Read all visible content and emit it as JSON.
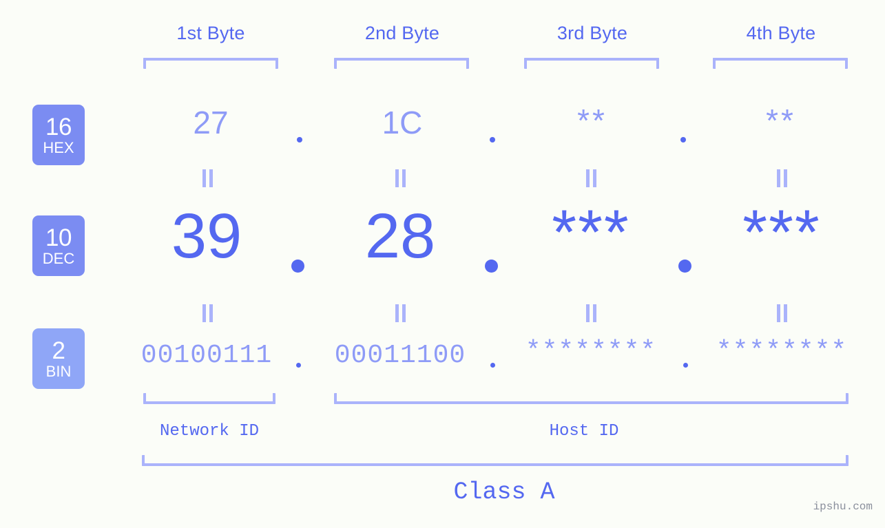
{
  "watermark": "ipshu.com",
  "header": {
    "bytes": [
      {
        "label": "1st Byte"
      },
      {
        "label": "2nd Byte"
      },
      {
        "label": "3rd Byte"
      },
      {
        "label": "4th Byte"
      }
    ]
  },
  "bases": [
    {
      "num": "16",
      "abbr": "HEX",
      "color": "#7b8cf2"
    },
    {
      "num": "10",
      "abbr": "DEC",
      "color": "#7b8cf2"
    },
    {
      "num": "2",
      "abbr": "BIN",
      "color": "#8fa6f7"
    }
  ],
  "rows": {
    "hex": {
      "base_num": "16",
      "base_abbr": "HEX",
      "values": [
        "27",
        "1C",
        "**",
        "**"
      ],
      "separator": "."
    },
    "dec": {
      "base_num": "10",
      "base_abbr": "DEC",
      "values": [
        "39",
        "28",
        "***",
        "***"
      ],
      "separator": "."
    },
    "bin": {
      "base_num": "2",
      "base_abbr": "BIN",
      "values": [
        "00100111",
        "00011100",
        "********",
        "********"
      ],
      "separator": "."
    }
  },
  "equals_glyph": "=",
  "footer": {
    "network_id_label": "Network ID",
    "host_id_label": "Host ID",
    "class_label": "Class A"
  },
  "colors": {
    "background": "#fbfdf8",
    "accent_strong": "#5468f0",
    "accent_mid": "#8e9bf7",
    "accent_light": "#aab3fb",
    "badge_hex": "#7b8cf2",
    "badge_dec": "#7b8cf2",
    "badge_bin": "#8fa6f7"
  }
}
